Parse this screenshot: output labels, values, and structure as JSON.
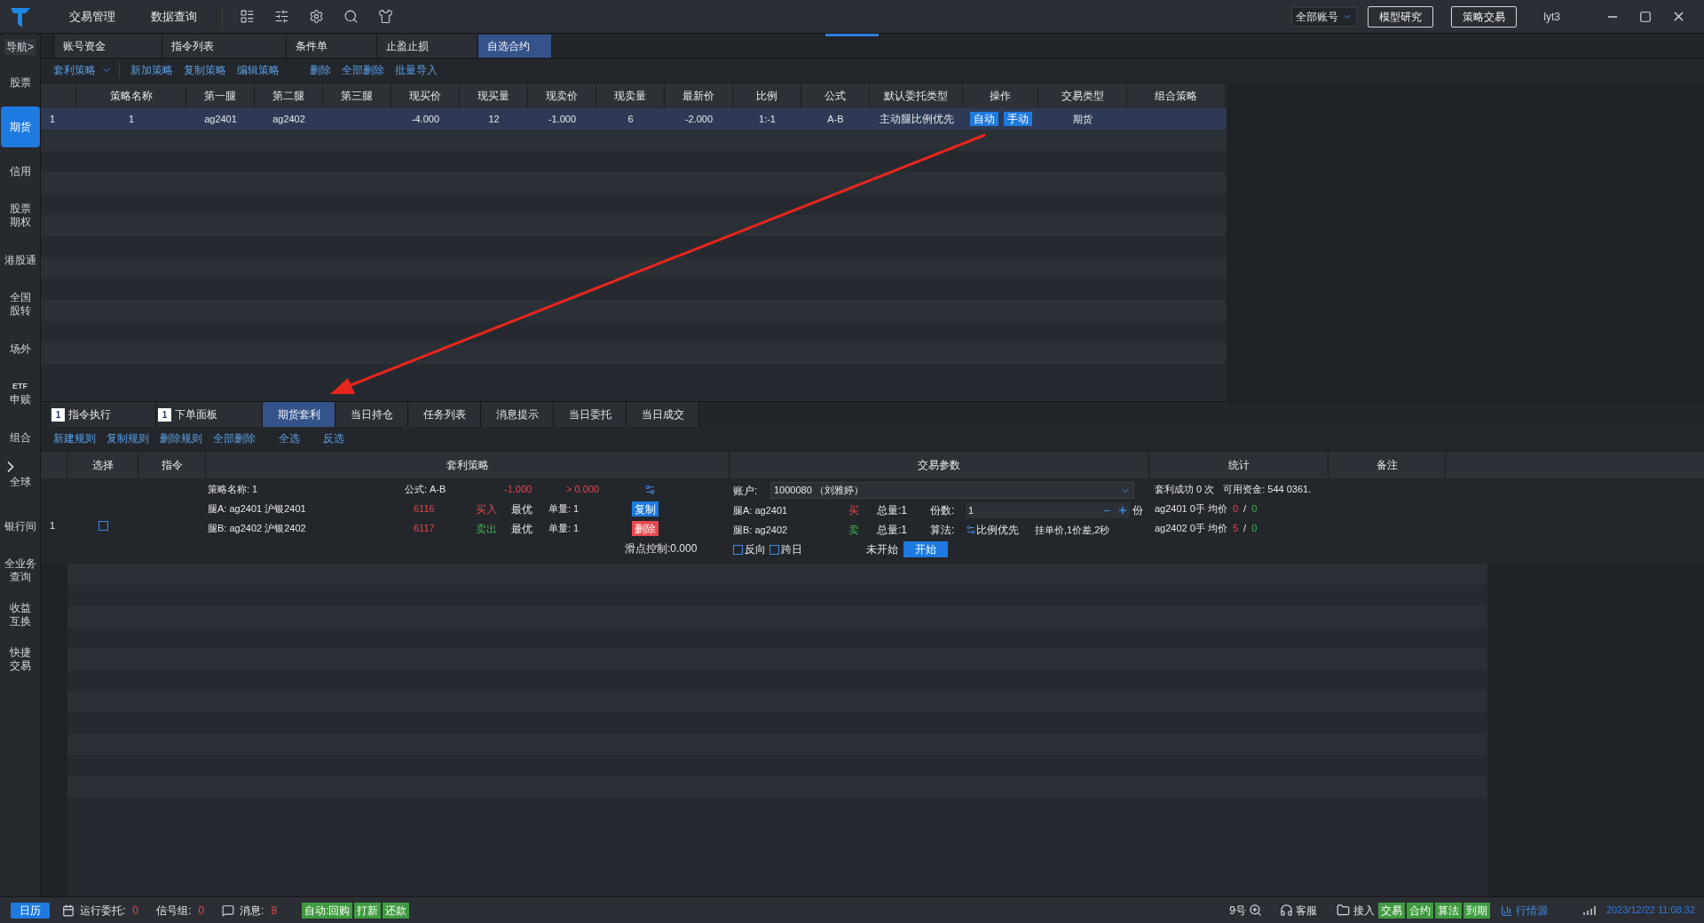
{
  "topbar": {
    "menus": [
      "交易管理",
      "数据查询"
    ],
    "account_select": "全部账号",
    "buttons": [
      "模型研究",
      "策略交易"
    ],
    "user": "lyt3"
  },
  "sidebar": {
    "header": "导航>",
    "items": [
      {
        "lines": [
          "股票"
        ],
        "selected": false
      },
      {
        "lines": [
          "期货"
        ],
        "selected": true
      },
      {
        "lines": [
          "信用"
        ],
        "selected": false
      },
      {
        "lines": [
          "股票",
          "期权"
        ],
        "selected": false
      },
      {
        "lines": [
          "港股通"
        ],
        "selected": false
      },
      {
        "lines": [
          "全国",
          "股转"
        ],
        "selected": false
      },
      {
        "lines": [
          "场外"
        ],
        "selected": false
      },
      {
        "lines": [
          "ETF",
          "申赎"
        ],
        "selected": false
      },
      {
        "lines": [
          "组合"
        ],
        "selected": false
      },
      {
        "lines": [
          "全球"
        ],
        "selected": false
      },
      {
        "lines": [
          "银行间"
        ],
        "selected": false
      },
      {
        "lines": [
          "全业务",
          "查询"
        ],
        "selected": false
      },
      {
        "lines": [
          "收益",
          "互换"
        ],
        "selected": false
      },
      {
        "lines": [
          "快捷",
          "交易"
        ],
        "selected": false
      }
    ]
  },
  "upper_tabs": [
    {
      "label": "账号资金",
      "selected": false
    },
    {
      "label": "指令列表",
      "selected": false
    },
    {
      "label": "条件单",
      "selected": false
    },
    {
      "label": "止盈止损",
      "selected": false
    },
    {
      "label": "自选合约",
      "selected": true
    }
  ],
  "upper_toolbar": {
    "dropdown": "套利策略",
    "actions": [
      "新加策略",
      "复制策略",
      "编辑策略",
      "删除",
      "全部删除",
      "批量导入"
    ]
  },
  "strategy_table": {
    "columns": [
      "策略名称",
      "第一腿",
      "第二腿",
      "第三腿",
      "现买价",
      "现买量",
      "现卖价",
      "现卖量",
      "最新价",
      "比例",
      "公式",
      "默认委托类型",
      "操作",
      "交易类型",
      "组合策略"
    ],
    "rows": [
      {
        "index": "1",
        "name": "1",
        "leg1": "ag2401",
        "leg2": "ag2402",
        "bid": "-4.000",
        "bid_qty": "12",
        "ask": "-1.000",
        "ask_qty": "6",
        "last": "-2.000",
        "ratio": "1:-1",
        "formula": "A-B",
        "order_type": "主动腿比例优先",
        "actions": [
          "自动",
          "手动"
        ],
        "trade_type": "期货",
        "selected": true
      }
    ]
  },
  "lower_tabs": [
    {
      "label": "指令执行",
      "badge": "1",
      "selected": false
    },
    {
      "label": "下单面板",
      "badge": "1",
      "selected": false
    },
    {
      "label": "期货套利",
      "selected": true
    },
    {
      "label": "当日持仓",
      "selected": false
    },
    {
      "label": "任务列表",
      "selected": false
    },
    {
      "label": "消息提示",
      "selected": false
    },
    {
      "label": "当日委托",
      "selected": false
    },
    {
      "label": "当日成交",
      "selected": false
    }
  ],
  "lower_toolbar": [
    "新建规则",
    "复制规则",
    "删除规则",
    "全部删除",
    "全选",
    "反选"
  ],
  "rules_table": {
    "columns": [
      "选择",
      "指令",
      "套利策略",
      "交易参数",
      "统计",
      "备注"
    ],
    "rows": [
      {
        "index": "1",
        "checked": false,
        "strategy": {
          "name": "策略名称: 1",
          "formula": "公式: A-B",
          "spread": "-1.000",
          "condition": "> 0.000",
          "legs": [
            {
              "label": "腿A: ag2401 沪银2401",
              "price": "6116",
              "side": "买入",
              "kind": "buy",
              "price_type": "最优",
              "qty": "单量: 1"
            },
            {
              "label": "腿B: ag2402 沪银2402",
              "price": "6117",
              "side": "卖出",
              "kind": "sell",
              "price_type": "最优",
              "qty": "单量: 1"
            }
          ],
          "copy": "复制",
          "delete": "删除",
          "slippage": "滑点控制:0.000"
        },
        "params": {
          "account_label": "账户:",
          "account": "1000080 （刘雅婷）",
          "legs": [
            {
              "label": "腿A: ag2401",
              "side": "买",
              "kind": "buy",
              "total": "总量:1"
            },
            {
              "label": "腿B: ag2402",
              "side": "卖",
              "kind": "sell",
              "total": "总量:1"
            }
          ],
          "shares_label": "份数:",
          "shares": "1",
          "unit": "份",
          "algo_label": "算法:",
          "algo": "比例优先",
          "algo_desc": "挂单价,1价差,2秒",
          "checks": [
            {
              "label": "反向",
              "checked": false
            },
            {
              "label": "跨日",
              "checked": false
            }
          ],
          "status": "未开始",
          "start": "开始"
        },
        "stats": {
          "success": "套利成功 0 次",
          "funds": "可用资金: 544 0361.",
          "legs": [
            {
              "label": "ag2401 0手 均价",
              "a": "0",
              "sep": "/",
              "b": "0"
            },
            {
              "label": "ag2402 0手 均价",
              "a": "5",
              "sep": "/",
              "b": "0"
            }
          ]
        }
      }
    ]
  },
  "status_bar": {
    "calendar": "日历",
    "running_label": "运行委托:",
    "running": "0",
    "signal_label": "信号组:",
    "signal": "0",
    "msg_label": "消息:",
    "msg": "8",
    "tags": [
      "自动:回购",
      "打新",
      "还款"
    ],
    "zoom": "9号",
    "service": "客服",
    "access": "接入",
    "access_tags": [
      "交易",
      "合约",
      "算法",
      "到期"
    ],
    "quote": "行情源",
    "datetime": "2023/12/22 11:08:32"
  }
}
